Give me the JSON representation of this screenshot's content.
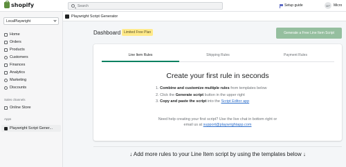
{
  "topbar": {
    "logo_text": "shopify",
    "search_placeholder": "Search",
    "setup_guide": "Setup guide",
    "avatar_initials": "MP",
    "user_name": "Micro"
  },
  "sidebar": {
    "store_name": "LocalPlaywright",
    "items": [
      {
        "label": "Home",
        "icon": "home-icon"
      },
      {
        "label": "Orders",
        "icon": "orders-icon"
      },
      {
        "label": "Products",
        "icon": "products-icon"
      },
      {
        "label": "Customers",
        "icon": "customers-icon"
      },
      {
        "label": "Finances",
        "icon": "finances-icon"
      },
      {
        "label": "Analytics",
        "icon": "analytics-icon"
      },
      {
        "label": "Marketing",
        "icon": "marketing-icon"
      },
      {
        "label": "Discounts",
        "icon": "discounts-icon"
      }
    ],
    "sales_channels_label": "Sales channels",
    "online_store": "Online Store",
    "apps_label": "Apps",
    "app_item": "Playwright Script Gener..."
  },
  "app_header": {
    "title": "Playwright Script Generator"
  },
  "main": {
    "title": "Dashboard",
    "badge": "Limited Free Plan",
    "generate_button": "Generate a Free Line Item Script",
    "tabs": [
      "Line Item Rules",
      "Shipping Rules",
      "Payment Rules"
    ],
    "headline": "Create your first rule in seconds",
    "steps": [
      {
        "num": "1.",
        "bold": "Combine and customize multiple rules",
        "rest": " from templates below"
      },
      {
        "num": "2.",
        "pre": "Click the ",
        "bold": "Generate script",
        "rest": " button in the upper right"
      },
      {
        "num": "3.",
        "bold": "Copy and paste the script",
        "rest": " into the ",
        "link": "Script Editor app"
      }
    ],
    "help_line1": "Need help creating your first script? Use the live chat in bottom right or",
    "help_line2_pre": "email us at ",
    "help_email": "support@playwrightapp.com",
    "bottom_text": "↓ Add more rules to your Line Item script by using the templates below ↓"
  },
  "colors": {
    "accent": "#008060",
    "badge_bg": "#ffea8a",
    "button_bg": "#95bf9f",
    "link": "#2c6ecb"
  }
}
